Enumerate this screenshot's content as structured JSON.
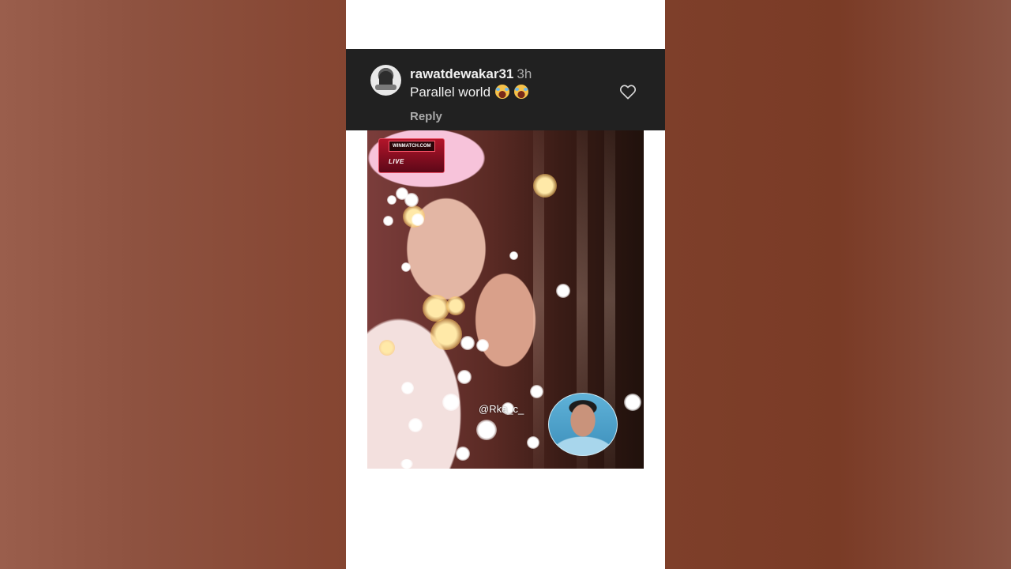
{
  "comment": {
    "username": "rawatdewakar31",
    "time": "3h",
    "text": "Parallel world",
    "reply_label": "Reply",
    "avatar_icon": "user-avatar",
    "like_icon": "heart-outline-icon",
    "emoji_icon": "laughing-face-emoji"
  },
  "video": {
    "badge_site": "WINMATCH.COM",
    "badge_live": "LIVE",
    "creator_handle": "@Rka_c_",
    "pip_icon": "presenter-face"
  },
  "colors": {
    "comment_bg": "#212121",
    "text_primary": "#f1f1f1",
    "text_secondary": "#aaaaaa",
    "page_bg": "#ffffff",
    "side_bg": "#8a4a35"
  }
}
